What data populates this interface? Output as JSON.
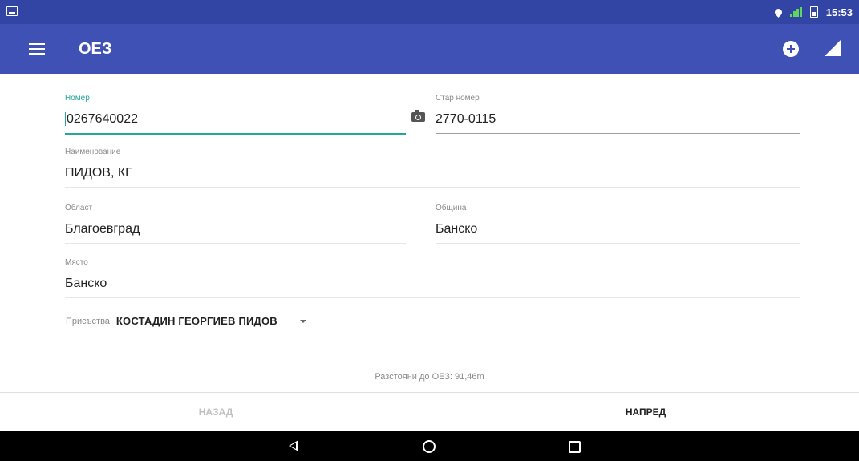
{
  "status_bar": {
    "time": "15:53"
  },
  "app_bar": {
    "title": "ОЕЗ"
  },
  "form": {
    "number": {
      "label": "Номер",
      "value": "0267640022"
    },
    "old_number": {
      "label": "Стар номер",
      "value": "2770-0115"
    },
    "name": {
      "label": "Наименование",
      "value": "ПИДОВ, КГ"
    },
    "region": {
      "label": "Област",
      "value": "Благоевград"
    },
    "municipality": {
      "label": "Община",
      "value": "Банско"
    },
    "place": {
      "label": "Място",
      "value": "Банско"
    },
    "present": {
      "label": "Присъства",
      "value": "КОСТАДИН ГЕОРГИЕВ ПИДОВ"
    }
  },
  "distance": "Разстояни до ОЕЗ: 91,46m",
  "buttons": {
    "back": "НАЗАД",
    "next": "НАПРЕД"
  },
  "icons": {
    "menu": "menu-icon",
    "add": "add-circle-icon",
    "signal": "signal-icon",
    "camera": "camera-icon",
    "dropdown": "dropdown-arrow-icon",
    "nav_back": "nav-back-icon",
    "nav_home": "nav-home-icon",
    "nav_recent": "nav-recent-icon"
  },
  "colors": {
    "primary": "#3f51b5",
    "status_bar": "#3245a4",
    "accent": "#26a69a"
  }
}
